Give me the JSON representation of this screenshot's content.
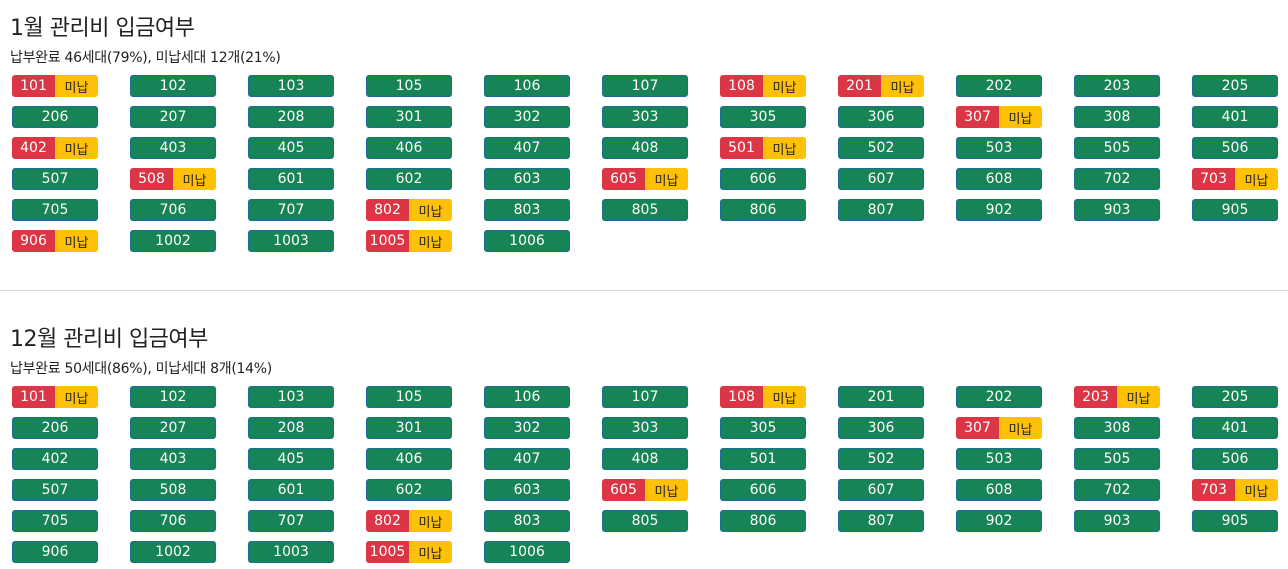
{
  "sections": [
    {
      "title": "1월 관리비 입금여부",
      "summary": "납부완료 46세대(79%), 미납세대 12개(21%)",
      "unpaid_tag": "미납",
      "units": [
        {
          "num": "101",
          "unpaid": true
        },
        {
          "num": "102",
          "unpaid": false
        },
        {
          "num": "103",
          "unpaid": false
        },
        {
          "num": "105",
          "unpaid": false
        },
        {
          "num": "106",
          "unpaid": false
        },
        {
          "num": "107",
          "unpaid": false
        },
        {
          "num": "108",
          "unpaid": true
        },
        {
          "num": "201",
          "unpaid": true
        },
        {
          "num": "202",
          "unpaid": false
        },
        {
          "num": "203",
          "unpaid": false
        },
        {
          "num": "205",
          "unpaid": false
        },
        {
          "num": "206",
          "unpaid": false
        },
        {
          "num": "207",
          "unpaid": false
        },
        {
          "num": "208",
          "unpaid": false
        },
        {
          "num": "301",
          "unpaid": false
        },
        {
          "num": "302",
          "unpaid": false
        },
        {
          "num": "303",
          "unpaid": false
        },
        {
          "num": "305",
          "unpaid": false
        },
        {
          "num": "306",
          "unpaid": false
        },
        {
          "num": "307",
          "unpaid": true
        },
        {
          "num": "308",
          "unpaid": false
        },
        {
          "num": "401",
          "unpaid": false
        },
        {
          "num": "402",
          "unpaid": true
        },
        {
          "num": "403",
          "unpaid": false
        },
        {
          "num": "405",
          "unpaid": false
        },
        {
          "num": "406",
          "unpaid": false
        },
        {
          "num": "407",
          "unpaid": false
        },
        {
          "num": "408",
          "unpaid": false
        },
        {
          "num": "501",
          "unpaid": true
        },
        {
          "num": "502",
          "unpaid": false
        },
        {
          "num": "503",
          "unpaid": false
        },
        {
          "num": "505",
          "unpaid": false
        },
        {
          "num": "506",
          "unpaid": false
        },
        {
          "num": "507",
          "unpaid": false
        },
        {
          "num": "508",
          "unpaid": true
        },
        {
          "num": "601",
          "unpaid": false
        },
        {
          "num": "602",
          "unpaid": false
        },
        {
          "num": "603",
          "unpaid": false
        },
        {
          "num": "605",
          "unpaid": true
        },
        {
          "num": "606",
          "unpaid": false
        },
        {
          "num": "607",
          "unpaid": false
        },
        {
          "num": "608",
          "unpaid": false
        },
        {
          "num": "702",
          "unpaid": false
        },
        {
          "num": "703",
          "unpaid": true
        },
        {
          "num": "705",
          "unpaid": false
        },
        {
          "num": "706",
          "unpaid": false
        },
        {
          "num": "707",
          "unpaid": false
        },
        {
          "num": "802",
          "unpaid": true
        },
        {
          "num": "803",
          "unpaid": false
        },
        {
          "num": "805",
          "unpaid": false
        },
        {
          "num": "806",
          "unpaid": false
        },
        {
          "num": "807",
          "unpaid": false
        },
        {
          "num": "902",
          "unpaid": false
        },
        {
          "num": "903",
          "unpaid": false
        },
        {
          "num": "905",
          "unpaid": false
        },
        {
          "num": "906",
          "unpaid": true
        },
        {
          "num": "1002",
          "unpaid": false
        },
        {
          "num": "1003",
          "unpaid": false
        },
        {
          "num": "1005",
          "unpaid": true
        },
        {
          "num": "1006",
          "unpaid": false
        }
      ]
    },
    {
      "title": "12월 관리비 입금여부",
      "summary": "납부완료 50세대(86%), 미납세대 8개(14%)",
      "unpaid_tag": "미납",
      "units": [
        {
          "num": "101",
          "unpaid": true
        },
        {
          "num": "102",
          "unpaid": false
        },
        {
          "num": "103",
          "unpaid": false
        },
        {
          "num": "105",
          "unpaid": false
        },
        {
          "num": "106",
          "unpaid": false
        },
        {
          "num": "107",
          "unpaid": false
        },
        {
          "num": "108",
          "unpaid": true
        },
        {
          "num": "201",
          "unpaid": false
        },
        {
          "num": "202",
          "unpaid": false
        },
        {
          "num": "203",
          "unpaid": true
        },
        {
          "num": "205",
          "unpaid": false
        },
        {
          "num": "206",
          "unpaid": false
        },
        {
          "num": "207",
          "unpaid": false
        },
        {
          "num": "208",
          "unpaid": false
        },
        {
          "num": "301",
          "unpaid": false
        },
        {
          "num": "302",
          "unpaid": false
        },
        {
          "num": "303",
          "unpaid": false
        },
        {
          "num": "305",
          "unpaid": false
        },
        {
          "num": "306",
          "unpaid": false
        },
        {
          "num": "307",
          "unpaid": true
        },
        {
          "num": "308",
          "unpaid": false
        },
        {
          "num": "401",
          "unpaid": false
        },
        {
          "num": "402",
          "unpaid": false
        },
        {
          "num": "403",
          "unpaid": false
        },
        {
          "num": "405",
          "unpaid": false
        },
        {
          "num": "406",
          "unpaid": false
        },
        {
          "num": "407",
          "unpaid": false
        },
        {
          "num": "408",
          "unpaid": false
        },
        {
          "num": "501",
          "unpaid": false
        },
        {
          "num": "502",
          "unpaid": false
        },
        {
          "num": "503",
          "unpaid": false
        },
        {
          "num": "505",
          "unpaid": false
        },
        {
          "num": "506",
          "unpaid": false
        },
        {
          "num": "507",
          "unpaid": false
        },
        {
          "num": "508",
          "unpaid": false
        },
        {
          "num": "601",
          "unpaid": false
        },
        {
          "num": "602",
          "unpaid": false
        },
        {
          "num": "603",
          "unpaid": false
        },
        {
          "num": "605",
          "unpaid": true
        },
        {
          "num": "606",
          "unpaid": false
        },
        {
          "num": "607",
          "unpaid": false
        },
        {
          "num": "608",
          "unpaid": false
        },
        {
          "num": "702",
          "unpaid": false
        },
        {
          "num": "703",
          "unpaid": true
        },
        {
          "num": "705",
          "unpaid": false
        },
        {
          "num": "706",
          "unpaid": false
        },
        {
          "num": "707",
          "unpaid": false
        },
        {
          "num": "802",
          "unpaid": true
        },
        {
          "num": "803",
          "unpaid": false
        },
        {
          "num": "805",
          "unpaid": false
        },
        {
          "num": "806",
          "unpaid": false
        },
        {
          "num": "807",
          "unpaid": false
        },
        {
          "num": "902",
          "unpaid": false
        },
        {
          "num": "903",
          "unpaid": false
        },
        {
          "num": "905",
          "unpaid": false
        },
        {
          "num": "906",
          "unpaid": false
        },
        {
          "num": "1002",
          "unpaid": false
        },
        {
          "num": "1003",
          "unpaid": false
        },
        {
          "num": "1005",
          "unpaid": true
        },
        {
          "num": "1006",
          "unpaid": false
        }
      ]
    }
  ],
  "colors": {
    "paid_bg": "#178455",
    "paid_border": "#1a6d96",
    "unpaid_num_bg": "#dc3545",
    "unpaid_tag_bg": "#ffc107"
  }
}
